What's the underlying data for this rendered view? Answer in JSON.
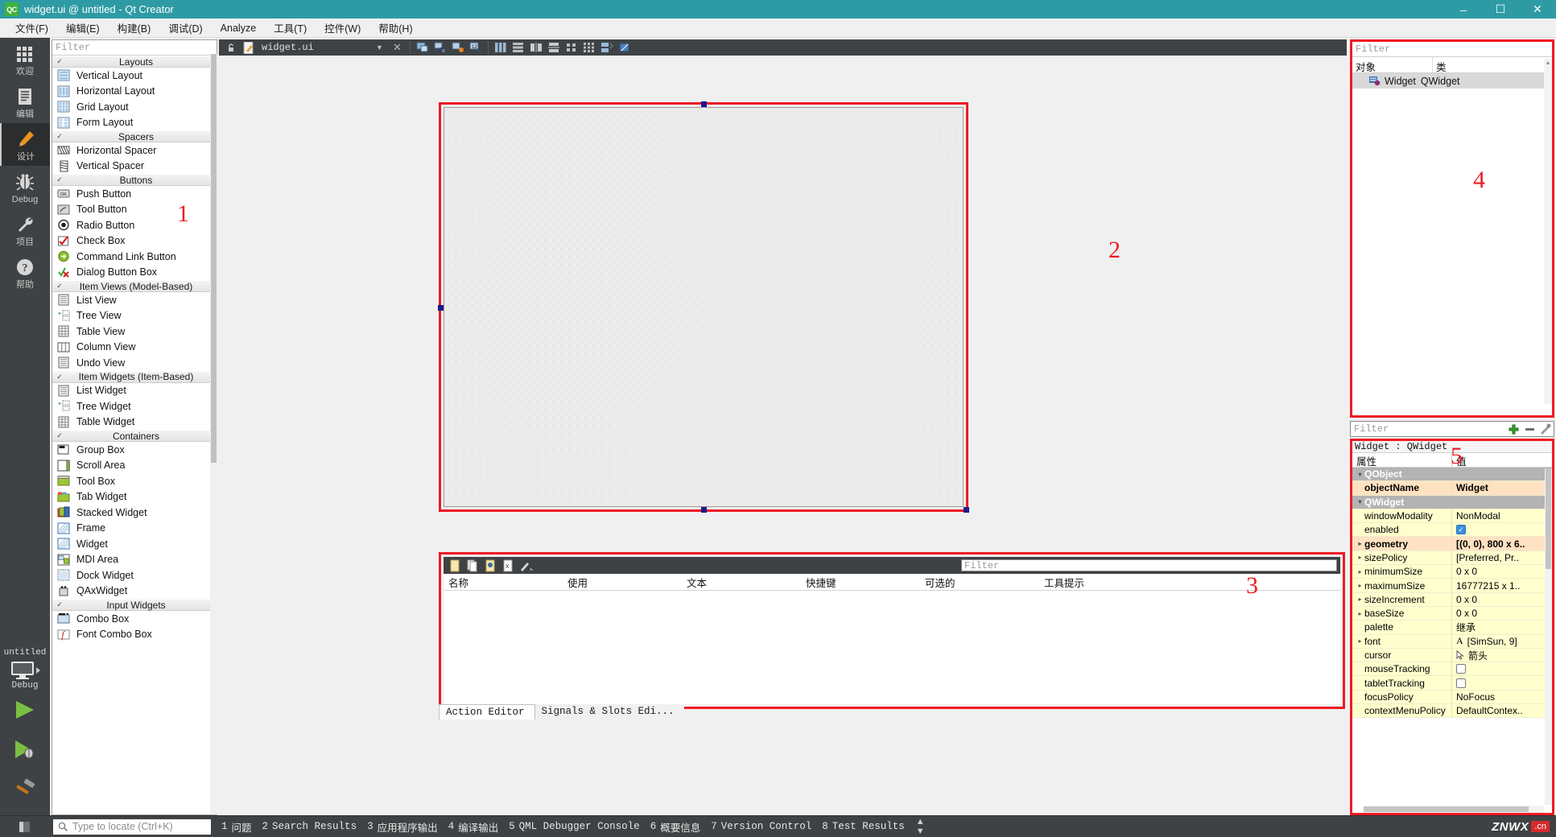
{
  "window": {
    "title": "widget.ui @ untitled - Qt Creator",
    "logo_text": "QC",
    "minimize": "–",
    "maximize": "☐",
    "close": "✕"
  },
  "menubar": {
    "items": [
      {
        "label": "文件(F)"
      },
      {
        "label": "编辑(E)"
      },
      {
        "label": "构建(B)"
      },
      {
        "label": "调试(D)"
      },
      {
        "label": "Analyze"
      },
      {
        "label": "工具(T)"
      },
      {
        "label": "控件(W)"
      },
      {
        "label": "帮助(H)"
      }
    ]
  },
  "modebar": {
    "items": [
      {
        "label": "欢迎",
        "icon": "grid-icon",
        "active": false
      },
      {
        "label": "编辑",
        "icon": "document-icon",
        "active": false
      },
      {
        "label": "设计",
        "icon": "pencil-icon",
        "active": true
      },
      {
        "label": "Debug",
        "icon": "bug-icon",
        "active": false
      },
      {
        "label": "项目",
        "icon": "wrench-icon",
        "active": false
      },
      {
        "label": "帮助",
        "icon": "help-icon",
        "active": false
      }
    ],
    "kit_name": "untitled",
    "build_config": "Debug",
    "kit_icon": "monitor-icon",
    "run_button": "run-icon",
    "debug_button": "debug-run-icon",
    "build_button": "hammer-icon"
  },
  "designer_toolbar": {
    "lock_icon": "lock-icon",
    "file_icon": "ui-file-icon",
    "filename": "widget.ui",
    "dropdown_icon": "chevron-down-icon",
    "close_icon": "close-icon",
    "tools": [
      {
        "name": "edit-widgets-icon"
      },
      {
        "name": "edit-signals-slots-icon"
      },
      {
        "name": "edit-buddies-icon"
      },
      {
        "name": "edit-tab-order-icon"
      },
      {
        "name": "layout-horizontally-icon"
      },
      {
        "name": "layout-vertically-icon"
      },
      {
        "name": "layout-in-splitter-h-icon"
      },
      {
        "name": "layout-in-splitter-v-icon"
      },
      {
        "name": "layout-in-form-icon"
      },
      {
        "name": "layout-in-grid-icon"
      },
      {
        "name": "break-layout-icon"
      },
      {
        "name": "adjust-size-icon"
      }
    ]
  },
  "widgetbox": {
    "region_number": "1",
    "filter_placeholder": "Filter",
    "groups": [
      {
        "name": "Layouts",
        "items": [
          {
            "label": "Vertical Layout",
            "icon": "vertical-layout-icon"
          },
          {
            "label": "Horizontal Layout",
            "icon": "horizontal-layout-icon"
          },
          {
            "label": "Grid Layout",
            "icon": "grid-layout-icon"
          },
          {
            "label": "Form Layout",
            "icon": "form-layout-icon"
          }
        ]
      },
      {
        "name": "Spacers",
        "items": [
          {
            "label": "Horizontal Spacer",
            "icon": "horizontal-spacer-icon"
          },
          {
            "label": "Vertical Spacer",
            "icon": "vertical-spacer-icon"
          }
        ]
      },
      {
        "name": "Buttons",
        "items": [
          {
            "label": "Push Button",
            "icon": "push-button-icon"
          },
          {
            "label": "Tool Button",
            "icon": "tool-button-icon"
          },
          {
            "label": "Radio Button",
            "icon": "radio-button-icon"
          },
          {
            "label": "Check Box",
            "icon": "check-box-icon"
          },
          {
            "label": "Command Link Button",
            "icon": "command-link-button-icon"
          },
          {
            "label": "Dialog Button Box",
            "icon": "dialog-button-box-icon"
          }
        ]
      },
      {
        "name": "Item Views (Model-Based)",
        "items": [
          {
            "label": "List View",
            "icon": "list-view-icon"
          },
          {
            "label": "Tree View",
            "icon": "tree-view-icon"
          },
          {
            "label": "Table View",
            "icon": "table-view-icon"
          },
          {
            "label": "Column View",
            "icon": "column-view-icon"
          },
          {
            "label": "Undo View",
            "icon": "undo-view-icon"
          }
        ]
      },
      {
        "name": "Item Widgets (Item-Based)",
        "items": [
          {
            "label": "List Widget",
            "icon": "list-widget-icon"
          },
          {
            "label": "Tree Widget",
            "icon": "tree-widget-icon"
          },
          {
            "label": "Table Widget",
            "icon": "table-widget-icon"
          }
        ]
      },
      {
        "name": "Containers",
        "items": [
          {
            "label": "Group Box",
            "icon": "group-box-icon"
          },
          {
            "label": "Scroll Area",
            "icon": "scroll-area-icon"
          },
          {
            "label": "Tool Box",
            "icon": "tool-box-icon"
          },
          {
            "label": "Tab Widget",
            "icon": "tab-widget-icon"
          },
          {
            "label": "Stacked Widget",
            "icon": "stacked-widget-icon"
          },
          {
            "label": "Frame",
            "icon": "frame-icon"
          },
          {
            "label": "Widget",
            "icon": "widget-icon"
          },
          {
            "label": "MDI Area",
            "icon": "mdi-area-icon"
          },
          {
            "label": "Dock Widget",
            "icon": "dock-widget-icon"
          },
          {
            "label": "QAxWidget",
            "icon": "qax-widget-icon"
          }
        ]
      },
      {
        "name": "Input Widgets",
        "items": [
          {
            "label": "Combo Box",
            "icon": "combo-box-icon"
          },
          {
            "label": "Font Combo Box",
            "icon": "font-combo-box-icon"
          }
        ]
      }
    ]
  },
  "form_canvas": {
    "region_number": "2"
  },
  "action_editor": {
    "region_number": "3",
    "filter_placeholder": "Filter",
    "toolbar": [
      {
        "name": "new-action-icon"
      },
      {
        "name": "copy-action-icon"
      },
      {
        "name": "edit-action-icon"
      },
      {
        "name": "delete-action-icon"
      },
      {
        "name": "configure-icon"
      }
    ],
    "columns": [
      {
        "label": "名称"
      },
      {
        "label": "使用"
      },
      {
        "label": "文本"
      },
      {
        "label": "快捷键"
      },
      {
        "label": "可选的"
      },
      {
        "label": "工具提示"
      }
    ],
    "tabs": [
      {
        "label": "Action Editor",
        "active": true
      },
      {
        "label": "Signals & Slots Edi...",
        "active": false
      }
    ]
  },
  "object_inspector": {
    "region_number": "4",
    "filter_placeholder": "Filter",
    "columns": [
      {
        "label": "对象"
      },
      {
        "label": "类"
      }
    ],
    "rows": [
      {
        "object": "Widget",
        "class": "QWidget",
        "icon": "widget-node-icon",
        "selected": true
      }
    ]
  },
  "property_editor": {
    "region_number": "5",
    "filter_placeholder": "Filter",
    "toolbar": [
      {
        "name": "add-property-icon"
      },
      {
        "name": "remove-property-icon"
      },
      {
        "name": "configure-property-icon"
      }
    ],
    "subject": "Widget : QWidget",
    "columns": [
      {
        "label": "属性"
      },
      {
        "label": "值"
      }
    ],
    "rows": [
      {
        "name": "QObject",
        "value": "",
        "kind": "category",
        "expander": "v"
      },
      {
        "name": "objectName",
        "value": "Widget",
        "kind": "peach",
        "expander": ""
      },
      {
        "name": "QWidget",
        "value": "",
        "kind": "category",
        "expander": "v"
      },
      {
        "name": "windowModality",
        "value": "NonModal",
        "kind": "yellow",
        "expander": ""
      },
      {
        "name": "enabled",
        "value": "",
        "kind": "yellow",
        "expander": "",
        "checkbox": "on"
      },
      {
        "name": "geometry",
        "value": "[(0, 0), 800 x 6..",
        "kind": "peach",
        "expander": ">"
      },
      {
        "name": "sizePolicy",
        "value": "[Preferred, Pr..",
        "kind": "yellow",
        "expander": ">"
      },
      {
        "name": "minimumSize",
        "value": "0 x 0",
        "kind": "yellow",
        "expander": ">"
      },
      {
        "name": "maximumSize",
        "value": "16777215 x 1..",
        "kind": "yellow",
        "expander": ">"
      },
      {
        "name": "sizeIncrement",
        "value": "0 x 0",
        "kind": "yellow",
        "expander": ">"
      },
      {
        "name": "baseSize",
        "value": "0 x 0",
        "kind": "yellow",
        "expander": ">"
      },
      {
        "name": "palette",
        "value": "继承",
        "kind": "yellow",
        "expander": ""
      },
      {
        "name": "font",
        "value": "[SimSun, 9]",
        "kind": "yellow",
        "expander": ">",
        "glyph": "A"
      },
      {
        "name": "cursor",
        "value": "箭头",
        "kind": "yellow",
        "expander": "",
        "glyph": "cursor"
      },
      {
        "name": "mouseTracking",
        "value": "",
        "kind": "yellow",
        "expander": "",
        "checkbox": "off"
      },
      {
        "name": "tabletTracking",
        "value": "",
        "kind": "yellow",
        "expander": "",
        "checkbox": "off"
      },
      {
        "name": "focusPolicy",
        "value": "NoFocus",
        "kind": "yellow",
        "expander": ""
      },
      {
        "name": "contextMenuPolicy",
        "value": "DefaultContex..",
        "kind": "yellow",
        "expander": ""
      }
    ]
  },
  "statusbar": {
    "locator_placeholder": "Type to locate (Ctrl+K)",
    "sidebar_toggle_icon": "sidebar-toggle-icon",
    "search_icon": "search-icon",
    "panes": [
      {
        "num": "1",
        "label": "问题"
      },
      {
        "num": "2",
        "label": "Search Results"
      },
      {
        "num": "3",
        "label": "应用程序输出"
      },
      {
        "num": "4",
        "label": "编译输出"
      },
      {
        "num": "5",
        "label": "QML Debugger Console"
      },
      {
        "num": "6",
        "label": "概要信息"
      },
      {
        "num": "7",
        "label": "Version Control"
      },
      {
        "num": "8",
        "label": "Test Results"
      }
    ],
    "updown_icon": "updown-icon",
    "watermark": "ZNWX",
    "watermark_suffix": ".cn"
  },
  "colors": {
    "titlebar": "#2e9ba4",
    "accent_red": "#ee1b24",
    "dark_panel": "#3f4244",
    "property_yellow": "#ffffce",
    "property_peach": "#ffe2c1"
  }
}
